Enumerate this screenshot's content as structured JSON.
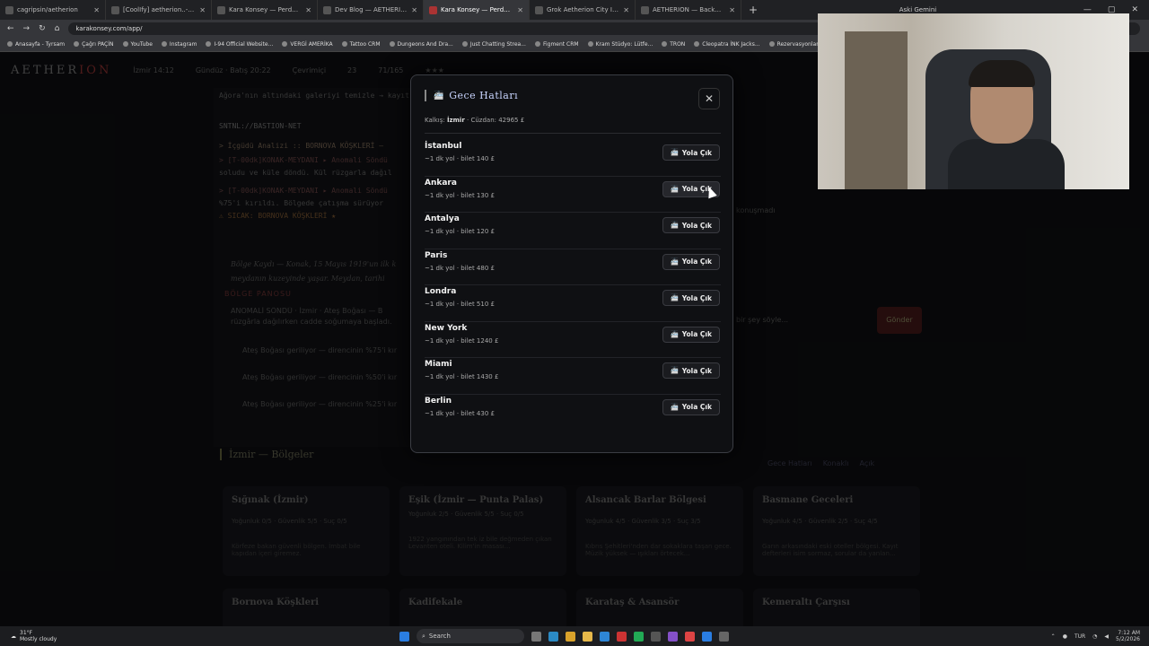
{
  "browser": {
    "tabs": [
      {
        "label": "cagripsin/aetherion"
      },
      {
        "label": "[CoolIfy] aetherion..- Deploym"
      },
      {
        "label": "Kara Konsey — Perde Aralanıyo"
      },
      {
        "label": "Dev Blog — AETHERION"
      },
      {
        "label": "Kara Konsey — Perde Aralanıyo"
      },
      {
        "label": "Grok Aetherion City Image Pro"
      },
      {
        "label": "AETHERION — BackOffice"
      }
    ],
    "new_tab": "+",
    "profile": "Aski Gemini",
    "url": "karakonsey.com/app/",
    "bookmarks": [
      "Anasayfa - Tyrsam",
      "Çağrı PAÇİN",
      "YouTube",
      "Instagram",
      "I-94 Official Website...",
      "VERGİ AMERİKA",
      "Tattoo CRM",
      "Dungeons And Dra...",
      "Just Chatting Strea...",
      "Figment CRM",
      "Kram Stüdyo: Lütfe...",
      "TRON",
      "Cleopatra İNK Jacks...",
      "Rezervasyonlar | Gke..."
    ]
  },
  "app": {
    "logo_main": "AETHER",
    "logo_accent": "ION",
    "nav": [
      "İzmir 14:12",
      "Gündüz · Batış 20:22",
      "Çevrimiçi",
      "23",
      "71/165",
      "★★★"
    ],
    "feed": [
      "Ağora'nın altındaki galeriyi temizle → kayıt yok",
      "SNTNL://BASTION-NET",
      "> İçgüdü Analizi :: BORNOVA KÖŞKLERİ —",
      "> [T-00dk]KONAK-MEYDANI ▸ Anomali Söndü",
      "soludu ve küle döndü. Kül rüzgarla dağıl",
      "> [T-00dk]KONAK-MEYDANI ▸ Anomali Söndü",
      "%75'i kırıldı. Bölgede çatışma sürüyor",
      "⚠ SICAK: BORNOVA KÖŞKLERİ ★"
    ],
    "panel_title": "BÖLGE PANOSU",
    "log": [
      "Bölge Kaydı — Konak, 15 Mayıs 1919'un ilk k",
      "meydanın kuzeyinde yaşar. Meydan, tarihi",
      "ANOMALİ SÖNDÜ · İzmir · Ateş Boğası — B",
      "rüzgârla dağılırken cadde soğumaya başladı.",
      "Ateş Boğası geriliyor — direncinin %75'i kır",
      "Ateş Boğası geriliyor — direncinin %50'i kır",
      "Ateş Boğası geriliyor — direncinin %25'i kır"
    ],
    "send": "Gönder",
    "input_placeholder": "bir şey söyle...",
    "right_note": "konuşmadı",
    "regions_title": "İzmir — Bölgeler",
    "region_tabs": [
      "Gece Hatları",
      "Konaklı",
      "Açık"
    ],
    "cards": [
      {
        "name": "Sığınak (İzmir)",
        "stats": "Yoğunluk 0/5 · Güvenlik 5/5 · Suç 0/5",
        "desc": "Körfeze bakan güvenli bölgen. İmbat bile kapıdan içeri giremez."
      },
      {
        "name": "Eşik (İzmir — Punta Palas)",
        "stats": "Yoğunluk 2/5 · Güvenlik 5/5 · Suç 0/5",
        "desc": "1922 yangınından tek iz bile değmeden çıkan Levanten oteli. Kilim'in masası..."
      },
      {
        "name": "Alsancak Barlar Bölgesi",
        "stats": "Yoğunluk 4/5 · Güvenlik 3/5 · Suç 3/5",
        "desc": "Kıbrıs Şehitleri'nden dar sokaklara taşan gece. Müzik yüksek — ışıkları örtecek..."
      },
      {
        "name": "Basmane Geceleri",
        "stats": "Yoğunluk 4/5 · Güvenlik 2/5 · Suç 4/5",
        "desc": "Garın arkasındaki eski oteller bölgesi. Kayıt defterleri isim sormaz, sorular da yanlan..."
      },
      {
        "name": "Bornova Köşkleri"
      },
      {
        "name": "Kadifekale"
      },
      {
        "name": "Karataş & Asansör"
      },
      {
        "name": "Kemeraltı Çarşısı"
      }
    ]
  },
  "modal": {
    "title": "Gece Hatları",
    "close": "✕",
    "departure_label": "Kalkış:",
    "departure_city": "İzmir",
    "wallet": "· Cüzdan: 42965 £",
    "button_label": "Yola Çık",
    "routes": [
      {
        "city": "İstanbul",
        "info": "~1 dk yol · bilet 140 £"
      },
      {
        "city": "Ankara",
        "info": "~1 dk yol · bilet 130 £"
      },
      {
        "city": "Antalya",
        "info": "~1 dk yol · bilet 120 £"
      },
      {
        "city": "Paris",
        "info": "~1 dk yol · bilet 480 £"
      },
      {
        "city": "Londra",
        "info": "~1 dk yol · bilet 510 £"
      },
      {
        "city": "New York",
        "info": "~1 dk yol · bilet 1240 £"
      },
      {
        "city": "Miami",
        "info": "~1 dk yol · bilet 1430 £"
      },
      {
        "city": "Berlin",
        "info": "~1 dk yol · bilet 430 £"
      }
    ]
  },
  "taskbar": {
    "weather_temp": "31°F",
    "weather_desc": "Mostly cloudy",
    "search": "Search",
    "lang": "TUR",
    "time": "7:12 AM",
    "date": "5/2/2026"
  }
}
